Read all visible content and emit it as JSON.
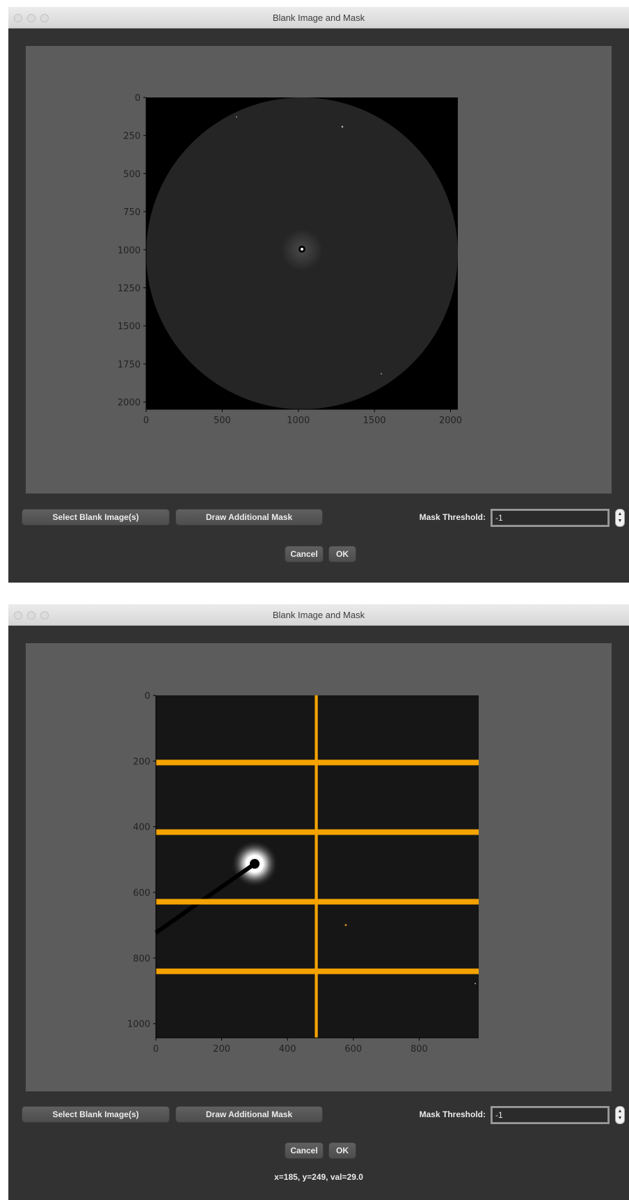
{
  "windows": [
    {
      "title": "Blank Image and Mask",
      "plot": {
        "x_ticks": [
          "0",
          "500",
          "1000",
          "1500",
          "2000"
        ],
        "y_ticks": [
          "0",
          "250",
          "500",
          "750",
          "1000",
          "1250",
          "1500",
          "1750",
          "2000"
        ]
      },
      "buttons": {
        "select_blank": "Select Blank Image(s)",
        "draw_mask": "Draw Additional Mask",
        "cancel": "Cancel",
        "ok": "OK"
      },
      "mask_threshold": {
        "label": "Mask Threshold:",
        "value": "-1"
      }
    },
    {
      "title": "Blank Image and Mask",
      "plot": {
        "x_ticks": [
          "0",
          "200",
          "400",
          "600",
          "800"
        ],
        "y_ticks": [
          "0",
          "200",
          "400",
          "600",
          "800",
          "1000"
        ],
        "mask_color": "#f5a300"
      },
      "buttons": {
        "select_blank": "Select Blank Image(s)",
        "draw_mask": "Draw Additional Mask",
        "cancel": "Cancel",
        "ok": "OK"
      },
      "mask_threshold": {
        "label": "Mask Threshold:",
        "value": "-1"
      },
      "status": "x=185, y=249, val=29.0"
    }
  ]
}
